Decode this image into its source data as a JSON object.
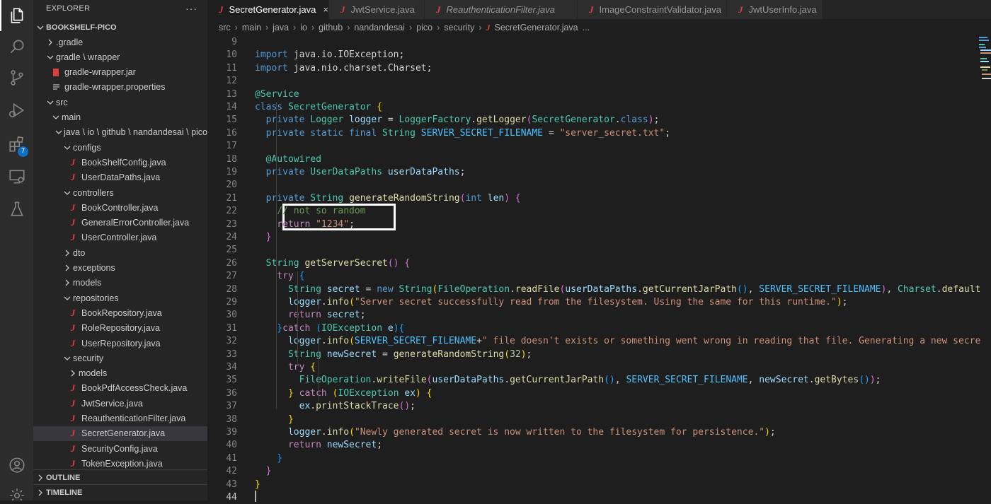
{
  "activity_bar": {
    "extensions_badge": "7"
  },
  "explorer": {
    "title": "EXPLORER",
    "more": "···",
    "project": "BOOKSHELF-PICO",
    "tree": [
      {
        "label": ".gradle",
        "type": "folder",
        "depth": 1,
        "expanded": false
      },
      {
        "label": "gradle \\ wrapper",
        "type": "folder",
        "depth": 1,
        "expanded": true
      },
      {
        "label": "gradle-wrapper.jar",
        "type": "jar",
        "depth": 2
      },
      {
        "label": "gradle-wrapper.properties",
        "type": "props",
        "depth": 2
      },
      {
        "label": "src",
        "type": "folder",
        "depth": 1,
        "expanded": true
      },
      {
        "label": "main",
        "type": "folder",
        "depth": 2,
        "expanded": true
      },
      {
        "label": "java \\ io \\ github \\ nandandesai \\ pico",
        "type": "folder",
        "depth": 3,
        "expanded": true
      },
      {
        "label": "configs",
        "type": "folder",
        "depth": 4,
        "expanded": true
      },
      {
        "label": "BookShelfConfig.java",
        "type": "java",
        "depth": 5
      },
      {
        "label": "UserDataPaths.java",
        "type": "java",
        "depth": 5
      },
      {
        "label": "controllers",
        "type": "folder",
        "depth": 4,
        "expanded": true
      },
      {
        "label": "BookController.java",
        "type": "java",
        "depth": 5
      },
      {
        "label": "GeneralErrorController.java",
        "type": "java",
        "depth": 5
      },
      {
        "label": "UserController.java",
        "type": "java",
        "depth": 5
      },
      {
        "label": "dto",
        "type": "folder",
        "depth": 4,
        "expanded": false
      },
      {
        "label": "exceptions",
        "type": "folder",
        "depth": 4,
        "expanded": false
      },
      {
        "label": "models",
        "type": "folder",
        "depth": 4,
        "expanded": false
      },
      {
        "label": "repositories",
        "type": "folder",
        "depth": 4,
        "expanded": true
      },
      {
        "label": "BookRepository.java",
        "type": "java",
        "depth": 5
      },
      {
        "label": "RoleRepository.java",
        "type": "java",
        "depth": 5
      },
      {
        "label": "UserRepository.java",
        "type": "java",
        "depth": 5
      },
      {
        "label": "security",
        "type": "folder",
        "depth": 4,
        "expanded": true
      },
      {
        "label": "models",
        "type": "folder",
        "depth": 5,
        "expanded": false
      },
      {
        "label": "BookPdfAccessCheck.java",
        "type": "java",
        "depth": 5
      },
      {
        "label": "JwtService.java",
        "type": "java",
        "depth": 5
      },
      {
        "label": "ReauthenticationFilter.java",
        "type": "java",
        "depth": 5
      },
      {
        "label": "SecretGenerator.java",
        "type": "java",
        "depth": 5,
        "selected": true
      },
      {
        "label": "SecurityConfig.java",
        "type": "java",
        "depth": 5
      },
      {
        "label": "TokenException.java",
        "type": "java",
        "depth": 5
      }
    ],
    "outline": "OUTLINE",
    "timeline": "TIMELINE"
  },
  "tabs": [
    {
      "label": "SecretGenerator.java",
      "active": true,
      "close": "×"
    },
    {
      "label": "JwtService.java",
      "active": false
    },
    {
      "label": "ReauthenticationFilter.java",
      "active": false,
      "italic": true
    },
    {
      "label": "ImageConstraintValidator.java",
      "active": false
    },
    {
      "label": "JwtUserInfo.java",
      "active": false
    }
  ],
  "breadcrumb": [
    "src",
    "main",
    "java",
    "io",
    "github",
    "nandandesai",
    "pico",
    "security",
    "SecretGenerator.java",
    "..."
  ],
  "editor": {
    "first_line": 9,
    "current_line": 44,
    "lines": [
      [],
      [
        [
          "kw",
          "import"
        ],
        [
          "",
          "  java.io.IOException;"
        ]
      ],
      [
        [
          "kw",
          "import"
        ],
        [
          "",
          "  java.nio.charset.Charset;"
        ]
      ],
      [],
      [
        [
          "ty",
          "@Service"
        ]
      ],
      [
        [
          "kw",
          "class"
        ],
        [
          "",
          ""
        ],
        [
          "ty",
          " SecretGenerator"
        ],
        [
          "",
          "  "
        ],
        [
          "p1",
          "{"
        ]
      ],
      [
        [
          "",
          ""
        ],
        [
          "kw",
          "    private"
        ],
        [
          "ty",
          "  Logger"
        ],
        [
          "var",
          "  logger"
        ],
        [
          "",
          "  =  "
        ],
        [
          "ty",
          "LoggerFactory"
        ],
        [
          "",
          ""
        ],
        [
          "",
          "."
        ],
        [
          "fn",
          "getLogger"
        ],
        [
          "p2",
          "("
        ],
        [
          "ty",
          "SecretGenerator"
        ],
        [
          "",
          "."
        ],
        [
          "kw",
          "class"
        ],
        [
          "p2",
          ")"
        ],
        [
          "",
          ";"
        ]
      ],
      [
        [
          "kw",
          "    private static final"
        ],
        [
          "ty",
          "  String"
        ],
        [
          "const",
          "  SERVER_SECRET_FILENAME"
        ],
        [
          "",
          "  =  "
        ],
        [
          "str",
          "\"server_secret.txt\""
        ],
        [
          "",
          ";"
        ]
      ],
      [],
      [
        [
          "ty",
          "    @Autowired"
        ]
      ],
      [
        [
          "kw",
          "    private"
        ],
        [
          "ty",
          "  UserDataPaths"
        ],
        [
          "var",
          "  userDataPaths"
        ],
        [
          "",
          ";"
        ]
      ],
      [],
      [
        [
          "kw",
          "    private"
        ],
        [
          "ty",
          "  String"
        ],
        [
          "fn",
          "  generateRandomString"
        ],
        [
          "p2",
          "("
        ],
        [
          "kw",
          "int"
        ],
        [
          "var",
          "  len"
        ],
        [
          "p2",
          ")"
        ],
        [
          "",
          "  "
        ],
        [
          "p2",
          "{"
        ]
      ],
      [
        [
          "cmt",
          "        // not so random"
        ]
      ],
      [
        [
          "ctl",
          "        return"
        ],
        [
          "str",
          "  \"1234\""
        ],
        [
          "",
          ";"
        ]
      ],
      [
        [
          "p2",
          "    }"
        ]
      ],
      [],
      [
        [
          "ty",
          "    String"
        ],
        [
          "fn",
          "  getServerSecret"
        ],
        [
          "p2",
          "()"
        ],
        [
          "",
          "  "
        ],
        [
          "p2",
          "{"
        ]
      ],
      [
        [
          "ctl",
          "        try"
        ],
        [
          "",
          "  "
        ],
        [
          "p3",
          "{"
        ]
      ],
      [
        [
          "ty",
          "            String"
        ],
        [
          "var",
          "  secret"
        ],
        [
          "",
          "  =  "
        ],
        [
          "kw",
          "new"
        ],
        [
          "ty",
          "  String"
        ],
        [
          "p1",
          "("
        ],
        [
          "ty",
          "FileOperation"
        ],
        [
          "",
          "."
        ],
        [
          "fn",
          "readFile"
        ],
        [
          "p2",
          "("
        ],
        [
          "var",
          "userDataPaths"
        ],
        [
          "",
          "."
        ],
        [
          "fn",
          "getCurrentJarPath"
        ],
        [
          "p3",
          "()"
        ],
        [
          "",
          ",  "
        ],
        [
          "const",
          "SERVER_SECRET_FILENAME"
        ],
        [
          "p2",
          ")"
        ],
        [
          "",
          ",  "
        ],
        [
          "ty",
          "Charset"
        ],
        [
          "",
          "."
        ],
        [
          "fn",
          "default"
        ]
      ],
      [
        [
          "var",
          "            logger"
        ],
        [
          "",
          "."
        ],
        [
          "fn",
          "info"
        ],
        [
          "p1",
          "("
        ],
        [
          "str",
          "\"Server secret successfully read from the filesystem. Using the same for this runtime.\""
        ],
        [
          "p1",
          ")"
        ],
        [
          "",
          ";"
        ]
      ],
      [
        [
          "ctl",
          "            return"
        ],
        [
          "var",
          "  secret"
        ],
        [
          "",
          ";"
        ]
      ],
      [
        [
          "p3",
          "        }"
        ],
        [
          "ctl",
          "catch"
        ],
        [
          "",
          "  "
        ],
        [
          "p3",
          "("
        ],
        [
          "ty",
          "IOException"
        ],
        [
          "var",
          "  e"
        ],
        [
          "p3",
          ")"
        ],
        [
          "p3",
          "{"
        ]
      ],
      [
        [
          "var",
          "            logger"
        ],
        [
          "",
          "."
        ],
        [
          "fn",
          "info"
        ],
        [
          "p1",
          "("
        ],
        [
          "const",
          "SERVER_SECRET_FILENAME"
        ],
        [
          "",
          "+"
        ],
        [
          "str",
          "\" file doesn't exists or something went wrong in reading that file. Generating a new secre"
        ]
      ],
      [
        [
          "ty",
          "            String"
        ],
        [
          "var",
          "  newSecret"
        ],
        [
          "",
          "  =  "
        ],
        [
          "fn",
          "generateRandomString"
        ],
        [
          "p1",
          "("
        ],
        [
          "num",
          "32"
        ],
        [
          "p1",
          ")"
        ],
        [
          "",
          ";"
        ]
      ],
      [
        [
          "ctl",
          "            try"
        ],
        [
          "",
          "  "
        ],
        [
          "p1",
          "{"
        ]
      ],
      [
        [
          "ty",
          "                FileOperation"
        ],
        [
          "",
          "."
        ],
        [
          "fn",
          "writeFile"
        ],
        [
          "p2",
          "("
        ],
        [
          "var",
          "userDataPaths"
        ],
        [
          "",
          "."
        ],
        [
          "fn",
          "getCurrentJarPath"
        ],
        [
          "p3",
          "()"
        ],
        [
          "",
          ",  "
        ],
        [
          "const",
          "SERVER_SECRET_FILENAME"
        ],
        [
          "",
          ",  "
        ],
        [
          "var",
          "newSecret"
        ],
        [
          "",
          "."
        ],
        [
          "fn",
          "getBytes"
        ],
        [
          "p3",
          "()"
        ],
        [
          "p2",
          ")"
        ],
        [
          "",
          ";"
        ]
      ],
      [
        [
          "p1",
          "            }"
        ],
        [
          "ctl",
          "  catch"
        ],
        [
          "",
          "  "
        ],
        [
          "p1",
          "("
        ],
        [
          "ty",
          "IOException"
        ],
        [
          "var",
          "  ex"
        ],
        [
          "p1",
          ")"
        ],
        [
          "",
          "  "
        ],
        [
          "p1",
          "{"
        ]
      ],
      [
        [
          "var",
          "                ex"
        ],
        [
          "",
          "."
        ],
        [
          "fn",
          "printStackTrace"
        ],
        [
          "p2",
          "()"
        ],
        [
          "",
          ";"
        ]
      ],
      [
        [
          "p1",
          "            }"
        ]
      ],
      [
        [
          "var",
          "            logger"
        ],
        [
          "",
          "."
        ],
        [
          "fn",
          "info"
        ],
        [
          "p1",
          "("
        ],
        [
          "str",
          "\"Newly generated secret is now written to the filesystem for persistence.\""
        ],
        [
          "p1",
          ")"
        ],
        [
          "",
          ";"
        ]
      ],
      [
        [
          "ctl",
          "            return"
        ],
        [
          "var",
          "  newSecret"
        ],
        [
          "",
          ";"
        ]
      ],
      [
        [
          "p3",
          "        }"
        ]
      ],
      [
        [
          "p2",
          "    }"
        ]
      ],
      [
        [
          "p1",
          "}"
        ]
      ],
      []
    ]
  }
}
